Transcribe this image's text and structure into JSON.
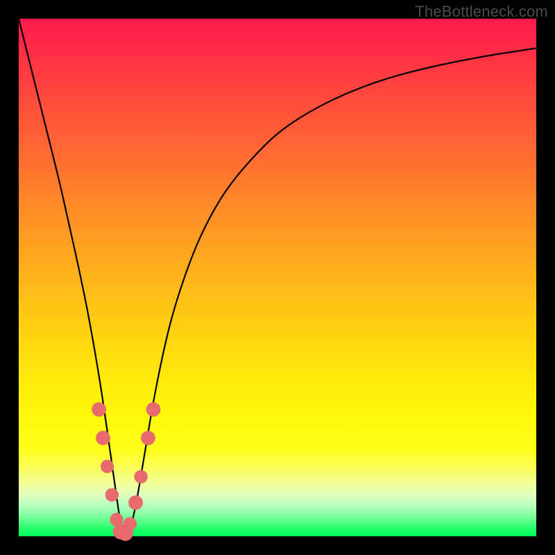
{
  "watermark": "TheBottleneck.com",
  "colors": {
    "frame_bg": "#000000",
    "curve_stroke": "#000000",
    "marker_fill": "#e76b6d",
    "marker_stroke": "#c24b4f"
  },
  "chart_data": {
    "type": "line",
    "title": "",
    "xlabel": "",
    "ylabel": "",
    "xlim": [
      0,
      100
    ],
    "ylim": [
      0,
      100
    ],
    "grid": false,
    "series": [
      {
        "name": "bottleneck-curve",
        "x": [
          0,
          2,
          4,
          6,
          8,
          10,
          12,
          14,
          16,
          17,
          18,
          19,
          19.5,
          20,
          20.5,
          21,
          22,
          23,
          24,
          25,
          26,
          28,
          30,
          33,
          36,
          40,
          45,
          50,
          56,
          63,
          71,
          80,
          90,
          100
        ],
        "y": [
          100,
          92,
          84,
          76,
          68,
          59,
          50,
          40,
          28,
          21,
          14,
          7,
          3.5,
          1,
          0.2,
          0.6,
          3,
          8,
          14,
          20,
          26,
          36,
          44,
          53,
          60,
          67,
          73,
          78,
          82,
          85.5,
          88.5,
          90.8,
          92.8,
          94.3
        ]
      }
    ],
    "markers": [
      {
        "x": 15.5,
        "y": 24.5,
        "r": 1.4
      },
      {
        "x": 16.3,
        "y": 19.0,
        "r": 1.4
      },
      {
        "x": 17.1,
        "y": 13.5,
        "r": 1.3
      },
      {
        "x": 18.0,
        "y": 8.0,
        "r": 1.3
      },
      {
        "x": 18.9,
        "y": 3.2,
        "r": 1.3
      },
      {
        "x": 19.7,
        "y": 0.9,
        "r": 1.5
      },
      {
        "x": 20.6,
        "y": 0.6,
        "r": 1.5
      },
      {
        "x": 21.5,
        "y": 2.4,
        "r": 1.3
      },
      {
        "x": 22.6,
        "y": 6.5,
        "r": 1.4
      },
      {
        "x": 23.6,
        "y": 11.5,
        "r": 1.3
      },
      {
        "x": 25.0,
        "y": 19.0,
        "r": 1.4
      },
      {
        "x": 26.0,
        "y": 24.5,
        "r": 1.4
      }
    ],
    "annotations": []
  }
}
